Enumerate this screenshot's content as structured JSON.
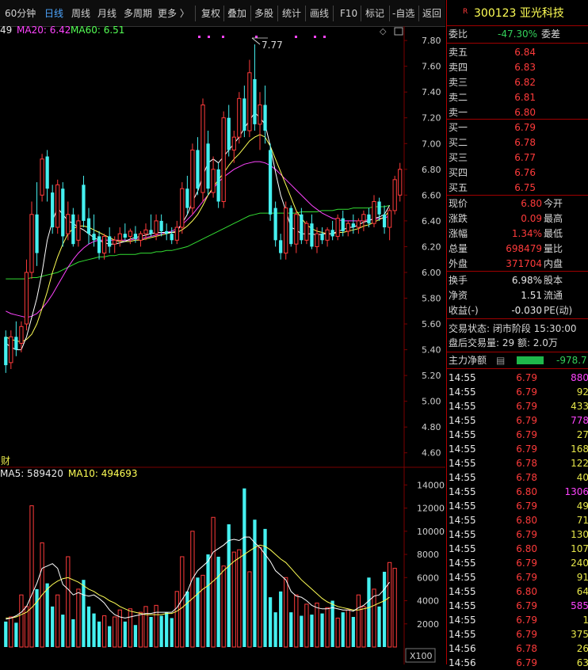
{
  "colors": {
    "up": "#ff3b3b",
    "down": "#45f0f0",
    "ma5": "#ffffff",
    "ma20": "#ff44ff",
    "ma60": "#33ff33",
    "ma10": "#ffff55"
  },
  "toolbar": {
    "items": [
      "60分钟",
      "日线",
      "周线",
      "月线",
      "多周期",
      "更多 〉",
      "复权",
      "叠加",
      "多股",
      "统计",
      "画线",
      "F10",
      "标记",
      "-自选",
      "返回"
    ],
    "active_index": 1
  },
  "price_legend": {
    "ma5_partial": "49",
    "ma20": "MA20: 6.42",
    "ma60": "MA60: 6.51"
  },
  "max_marker": "7.77",
  "price_axis": [
    "7.80",
    "7.60",
    "7.40",
    "7.20",
    "7.00",
    "6.80",
    "6.60",
    "6.40",
    "6.20",
    "6.00",
    "5.80",
    "5.60",
    "5.40",
    "5.20",
    "5.00",
    "4.80",
    "4.60"
  ],
  "finance_tag": "财",
  "vol_legend": {
    "ma5": "MA5: 589420",
    "ma10": "MA10: 494693"
  },
  "vol_axis": [
    "14000",
    "12000",
    "10000",
    "8000",
    "6000",
    "4000",
    "2000"
  ],
  "vol_unit": "X100",
  "stock": {
    "badge": "R",
    "code_name": "300123 亚光科技"
  },
  "weibi": {
    "label": "委比",
    "value": "-47.30%",
    "label2": "委差"
  },
  "asks": [
    {
      "label": "卖五",
      "price": "6.84"
    },
    {
      "label": "卖四",
      "price": "6.83"
    },
    {
      "label": "卖三",
      "price": "6.82"
    },
    {
      "label": "卖二",
      "price": "6.81"
    },
    {
      "label": "卖一",
      "price": "6.80"
    }
  ],
  "bids": [
    {
      "label": "买一",
      "price": "6.79"
    },
    {
      "label": "买二",
      "price": "6.78"
    },
    {
      "label": "买三",
      "price": "6.77"
    },
    {
      "label": "买四",
      "price": "6.76"
    },
    {
      "label": "买五",
      "price": "6.75"
    }
  ],
  "quote": [
    {
      "label": "现价",
      "value": "6.80",
      "label2": "今开"
    },
    {
      "label": "涨跌",
      "value": "0.09",
      "label2": "最高"
    },
    {
      "label": "涨幅",
      "value": "1.34%",
      "label2": "最低"
    },
    {
      "label": "总量",
      "value": "698479",
      "label2": "量比"
    },
    {
      "label": "外盘",
      "value": "371704",
      "label2": "内盘"
    }
  ],
  "stats": [
    {
      "label": "换手",
      "value": "6.98%",
      "label2": "股本"
    },
    {
      "label": "净资",
      "value": "1.51",
      "label2": "流通"
    },
    {
      "label": "收益(-)",
      "value": "-0.030",
      "label2": "PE(动)"
    }
  ],
  "status": {
    "line1": "交易状态: 闭市阶段 15:30:00",
    "line2": "盘后交易量: 29  额: 2.0万"
  },
  "main_flow": {
    "label": "主力净额",
    "value": "-978.7"
  },
  "ticks": [
    {
      "t": "14:55",
      "p": "6.79",
      "v": "880",
      "c": "mag"
    },
    {
      "t": "14:55",
      "p": "6.79",
      "v": "92",
      "c": "yel"
    },
    {
      "t": "14:55",
      "p": "6.79",
      "v": "433",
      "c": "yel"
    },
    {
      "t": "14:55",
      "p": "6.79",
      "v": "778",
      "c": "mag"
    },
    {
      "t": "14:55",
      "p": "6.79",
      "v": "27",
      "c": "yel"
    },
    {
      "t": "14:55",
      "p": "6.79",
      "v": "168",
      "c": "yel"
    },
    {
      "t": "14:55",
      "p": "6.78",
      "v": "122",
      "c": "yel"
    },
    {
      "t": "14:55",
      "p": "6.78",
      "v": "40",
      "c": "yel"
    },
    {
      "t": "14:55",
      "p": "6.80",
      "v": "1306",
      "c": "mag"
    },
    {
      "t": "14:55",
      "p": "6.79",
      "v": "49",
      "c": "yel"
    },
    {
      "t": "14:55",
      "p": "6.80",
      "v": "71",
      "c": "yel"
    },
    {
      "t": "14:55",
      "p": "6.79",
      "v": "130",
      "c": "yel"
    },
    {
      "t": "14:55",
      "p": "6.80",
      "v": "107",
      "c": "yel"
    },
    {
      "t": "14:55",
      "p": "6.79",
      "v": "240",
      "c": "yel"
    },
    {
      "t": "14:55",
      "p": "6.79",
      "v": "91",
      "c": "yel"
    },
    {
      "t": "14:55",
      "p": "6.80",
      "v": "64",
      "c": "yel"
    },
    {
      "t": "14:55",
      "p": "6.79",
      "v": "585",
      "c": "mag"
    },
    {
      "t": "14:55",
      "p": "6.79",
      "v": "1",
      "c": "yel"
    },
    {
      "t": "14:55",
      "p": "6.79",
      "v": "375",
      "c": "yel"
    },
    {
      "t": "14:56",
      "p": "6.78",
      "v": "26",
      "c": "yel"
    },
    {
      "t": "14:56",
      "p": "6.79",
      "v": "63",
      "c": "yel"
    }
  ],
  "chart_data": {
    "type": "candlestick",
    "title": "",
    "y_range": [
      4.5,
      7.85
    ],
    "vol_range": [
      0,
      14500
    ],
    "series": [
      {
        "o": 5.5,
        "h": 5.55,
        "l": 5.22,
        "c": 5.28
      },
      {
        "o": 5.3,
        "h": 5.55,
        "l": 5.25,
        "c": 5.5
      },
      {
        "o": 5.5,
        "h": 5.62,
        "l": 5.35,
        "c": 5.4
      },
      {
        "o": 5.45,
        "h": 5.62,
        "l": 5.38,
        "c": 5.58
      },
      {
        "o": 5.6,
        "h": 6.1,
        "l": 5.55,
        "c": 6.0
      },
      {
        "o": 6.0,
        "h": 6.55,
        "l": 5.95,
        "c": 6.45
      },
      {
        "o": 6.45,
        "h": 6.7,
        "l": 6.05,
        "c": 6.15
      },
      {
        "o": 6.6,
        "h": 6.92,
        "l": 6.55,
        "c": 6.88
      },
      {
        "o": 6.9,
        "h": 6.95,
        "l": 6.55,
        "c": 6.65
      },
      {
        "o": 6.62,
        "h": 6.68,
        "l": 6.3,
        "c": 6.35
      },
      {
        "o": 6.35,
        "h": 6.72,
        "l": 6.3,
        "c": 6.68
      },
      {
        "o": 6.65,
        "h": 6.7,
        "l": 6.2,
        "c": 6.28
      },
      {
        "o": 6.3,
        "h": 6.55,
        "l": 6.25,
        "c": 6.45
      },
      {
        "o": 6.45,
        "h": 6.5,
        "l": 6.2,
        "c": 6.22
      },
      {
        "o": 6.25,
        "h": 6.45,
        "l": 6.2,
        "c": 6.4
      },
      {
        "o": 6.68,
        "h": 6.75,
        "l": 6.35,
        "c": 6.4
      },
      {
        "o": 6.42,
        "h": 6.5,
        "l": 6.22,
        "c": 6.3
      },
      {
        "o": 6.3,
        "h": 6.45,
        "l": 6.2,
        "c": 6.25
      },
      {
        "o": 6.28,
        "h": 6.32,
        "l": 6.1,
        "c": 6.15
      },
      {
        "o": 6.15,
        "h": 6.3,
        "l": 6.1,
        "c": 6.28
      },
      {
        "o": 6.28,
        "h": 6.35,
        "l": 6.15,
        "c": 6.2
      },
      {
        "o": 6.22,
        "h": 6.28,
        "l": 6.15,
        "c": 6.25
      },
      {
        "o": 6.25,
        "h": 6.35,
        "l": 6.2,
        "c": 6.3
      },
      {
        "o": 6.3,
        "h": 6.38,
        "l": 6.25,
        "c": 6.27
      },
      {
        "o": 6.28,
        "h": 6.34,
        "l": 6.22,
        "c": 6.32
      },
      {
        "o": 6.3,
        "h": 6.36,
        "l": 6.23,
        "c": 6.26
      },
      {
        "o": 6.25,
        "h": 6.32,
        "l": 6.2,
        "c": 6.3
      },
      {
        "o": 6.3,
        "h": 6.38,
        "l": 6.25,
        "c": 6.33
      },
      {
        "o": 6.33,
        "h": 6.45,
        "l": 6.28,
        "c": 6.3
      },
      {
        "o": 6.3,
        "h": 6.45,
        "l": 6.25,
        "c": 6.4
      },
      {
        "o": 6.4,
        "h": 6.45,
        "l": 6.28,
        "c": 6.32
      },
      {
        "o": 6.32,
        "h": 6.38,
        "l": 6.25,
        "c": 6.3
      },
      {
        "o": 6.3,
        "h": 6.35,
        "l": 6.22,
        "c": 6.25
      },
      {
        "o": 6.25,
        "h": 6.4,
        "l": 6.22,
        "c": 6.35
      },
      {
        "o": 6.35,
        "h": 6.7,
        "l": 6.3,
        "c": 6.65
      },
      {
        "o": 6.65,
        "h": 6.75,
        "l": 6.45,
        "c": 6.5
      },
      {
        "o": 6.5,
        "h": 7.0,
        "l": 6.45,
        "c": 6.95
      },
      {
        "o": 6.95,
        "h": 7.05,
        "l": 6.6,
        "c": 6.65
      },
      {
        "o": 6.62,
        "h": 7.35,
        "l": 6.55,
        "c": 7.3
      },
      {
        "o": 7.0,
        "h": 7.1,
        "l": 6.6,
        "c": 6.65
      },
      {
        "o": 6.62,
        "h": 6.9,
        "l": 6.58,
        "c": 6.8
      },
      {
        "o": 6.8,
        "h": 6.85,
        "l": 6.5,
        "c": 6.55
      },
      {
        "o": 6.55,
        "h": 7.25,
        "l": 6.5,
        "c": 7.2
      },
      {
        "o": 7.2,
        "h": 7.3,
        "l": 6.9,
        "c": 6.95
      },
      {
        "o": 6.95,
        "h": 7.1,
        "l": 6.85,
        "c": 7.05
      },
      {
        "o": 7.05,
        "h": 7.4,
        "l": 7.0,
        "c": 7.35
      },
      {
        "o": 7.35,
        "h": 7.45,
        "l": 7.05,
        "c": 7.1
      },
      {
        "o": 7.1,
        "h": 7.65,
        "l": 7.05,
        "c": 7.55
      },
      {
        "o": 7.5,
        "h": 7.77,
        "l": 7.1,
        "c": 7.15
      },
      {
        "o": 7.15,
        "h": 7.4,
        "l": 6.95,
        "c": 7.3
      },
      {
        "o": 7.3,
        "h": 7.45,
        "l": 7.0,
        "c": 7.1
      },
      {
        "o": 6.95,
        "h": 7.0,
        "l": 6.4,
        "c": 6.45
      },
      {
        "o": 6.5,
        "h": 6.55,
        "l": 6.2,
        "c": 6.25
      },
      {
        "o": 6.25,
        "h": 6.3,
        "l": 6.1,
        "c": 6.15
      },
      {
        "o": 6.15,
        "h": 6.55,
        "l": 6.1,
        "c": 6.5
      },
      {
        "o": 6.5,
        "h": 6.52,
        "l": 6.2,
        "c": 6.22
      },
      {
        "o": 6.22,
        "h": 6.48,
        "l": 6.15,
        "c": 6.45
      },
      {
        "o": 6.45,
        "h": 6.5,
        "l": 6.22,
        "c": 6.25
      },
      {
        "o": 6.25,
        "h": 6.4,
        "l": 6.22,
        "c": 6.38
      },
      {
        "o": 6.38,
        "h": 6.45,
        "l": 6.18,
        "c": 6.2
      },
      {
        "o": 6.2,
        "h": 6.35,
        "l": 6.15,
        "c": 6.3
      },
      {
        "o": 6.3,
        "h": 6.35,
        "l": 6.22,
        "c": 6.25
      },
      {
        "o": 6.25,
        "h": 6.35,
        "l": 6.2,
        "c": 6.33
      },
      {
        "o": 6.33,
        "h": 6.4,
        "l": 6.25,
        "c": 6.28
      },
      {
        "o": 6.28,
        "h": 6.45,
        "l": 6.25,
        "c": 6.42
      },
      {
        "o": 6.42,
        "h": 6.48,
        "l": 6.28,
        "c": 6.32
      },
      {
        "o": 6.32,
        "h": 6.4,
        "l": 6.28,
        "c": 6.38
      },
      {
        "o": 6.38,
        "h": 6.45,
        "l": 6.3,
        "c": 6.35
      },
      {
        "o": 6.35,
        "h": 6.42,
        "l": 6.3,
        "c": 6.4
      },
      {
        "o": 6.4,
        "h": 6.48,
        "l": 6.32,
        "c": 6.45
      },
      {
        "o": 6.45,
        "h": 6.5,
        "l": 6.35,
        "c": 6.38
      },
      {
        "o": 6.38,
        "h": 6.6,
        "l": 6.35,
        "c": 6.55
      },
      {
        "o": 6.55,
        "h": 6.58,
        "l": 6.4,
        "c": 6.45
      },
      {
        "o": 6.45,
        "h": 6.52,
        "l": 6.3,
        "c": 6.35
      },
      {
        "o": 6.35,
        "h": 6.5,
        "l": 6.25,
        "c": 6.48
      },
      {
        "o": 6.48,
        "h": 6.75,
        "l": 6.45,
        "c": 6.72
      },
      {
        "o": 6.6,
        "h": 6.85,
        "l": 6.55,
        "c": 6.8
      }
    ],
    "volume": [
      2200,
      2600,
      2100,
      4500,
      3500,
      12200,
      5000,
      9000,
      5500,
      3500,
      4500,
      2800,
      7800,
      2400,
      5000,
      5800,
      3500,
      2900,
      2200,
      2700,
      1800,
      2600,
      3200,
      2200,
      3300,
      1900,
      3000,
      3500,
      2600,
      3600,
      2700,
      3000,
      2500,
      4800,
      7800,
      4800,
      10000,
      6000,
      6200,
      8000,
      11200,
      7800,
      7000,
      10600,
      8200,
      8400,
      13700,
      6500,
      11000,
      8600,
      10200,
      4300,
      3000,
      4800,
      6000,
      3000,
      4500,
      2700,
      3700,
      2800,
      3800,
      2900,
      3400,
      4000,
      2500,
      3000,
      3200,
      2600,
      4500,
      3500,
      6000,
      5000,
      3500,
      6500,
      7300,
      6800
    ],
    "ma5": [
      5.45,
      5.42,
      5.4,
      5.4,
      5.5,
      5.65,
      5.8,
      6.0,
      6.25,
      6.4,
      6.5,
      6.45,
      6.4,
      6.38,
      6.35,
      6.33,
      6.3,
      6.27,
      6.25,
      6.23,
      6.22,
      6.22,
      6.23,
      6.24,
      6.26,
      6.27,
      6.28,
      6.29,
      6.3,
      6.31,
      6.31,
      6.31,
      6.31,
      6.32,
      6.38,
      6.45,
      6.55,
      6.63,
      6.75,
      6.85,
      6.88,
      6.85,
      6.9,
      6.95,
      7.0,
      7.05,
      7.12,
      7.18,
      7.24,
      7.2,
      7.15,
      6.98,
      6.78,
      6.6,
      6.48,
      6.35,
      6.33,
      6.3,
      6.3,
      6.3,
      6.29,
      6.3,
      6.3,
      6.3,
      6.32,
      6.33,
      6.35,
      6.35,
      6.37,
      6.39,
      6.4,
      6.42,
      6.43,
      6.45,
      6.52
    ],
    "ma10": [
      5.5,
      5.48,
      5.47,
      5.46,
      5.48,
      5.52,
      5.6,
      5.72,
      5.85,
      6.0,
      6.12,
      6.22,
      6.3,
      6.34,
      6.36,
      6.36,
      6.35,
      6.33,
      6.31,
      6.29,
      6.27,
      6.25,
      6.24,
      6.24,
      6.24,
      6.25,
      6.25,
      6.26,
      6.27,
      6.28,
      6.29,
      6.3,
      6.31,
      6.31,
      6.33,
      6.36,
      6.4,
      6.45,
      6.52,
      6.6,
      6.66,
      6.72,
      6.77,
      6.83,
      6.88,
      6.92,
      6.97,
      7.02,
      7.05,
      7.07,
      7.05,
      6.98,
      6.88,
      6.78,
      6.68,
      6.58,
      6.48,
      6.42,
      6.37,
      6.34,
      6.32,
      6.31,
      6.3,
      6.3,
      6.31,
      6.31,
      6.32,
      6.33,
      6.34,
      6.36,
      6.37,
      6.39,
      6.41,
      6.43,
      6.48
    ],
    "ma20": [
      5.7,
      5.68,
      5.67,
      5.66,
      5.65,
      5.66,
      5.68,
      5.72,
      5.77,
      5.83,
      5.9,
      5.97,
      6.04,
      6.1,
      6.15,
      6.19,
      6.22,
      6.24,
      6.25,
      6.25,
      6.25,
      6.25,
      6.25,
      6.25,
      6.25,
      6.26,
      6.26,
      6.27,
      6.28,
      6.29,
      6.3,
      6.31,
      6.32,
      6.34,
      6.37,
      6.41,
      6.45,
      6.5,
      6.55,
      6.6,
      6.65,
      6.7,
      6.74,
      6.77,
      6.8,
      6.82,
      6.84,
      6.85,
      6.86,
      6.86,
      6.85,
      6.83,
      6.8,
      6.76,
      6.72,
      6.68,
      6.64,
      6.6,
      6.56,
      6.52,
      6.49,
      6.46,
      6.44,
      6.42,
      6.41,
      6.4,
      6.4,
      6.4,
      6.4,
      6.4,
      6.41,
      6.41,
      6.42,
      6.42,
      6.44
    ],
    "ma60": [
      5.95,
      5.95,
      5.95,
      5.95,
      5.95,
      5.96,
      5.96,
      5.97,
      5.98,
      5.99,
      6.0,
      6.02,
      6.04,
      6.06,
      6.08,
      6.09,
      6.1,
      6.11,
      6.12,
      6.12,
      6.13,
      6.13,
      6.14,
      6.14,
      6.14,
      6.14,
      6.15,
      6.15,
      6.15,
      6.16,
      6.16,
      6.17,
      6.17,
      6.18,
      6.19,
      6.2,
      6.22,
      6.24,
      6.26,
      6.28,
      6.3,
      6.32,
      6.34,
      6.36,
      6.38,
      6.4,
      6.42,
      6.44,
      6.45,
      6.46,
      6.46,
      6.46,
      6.46,
      6.46,
      6.46,
      6.46,
      6.46,
      6.47,
      6.47,
      6.47,
      6.47,
      6.48,
      6.48,
      6.48,
      6.49,
      6.49,
      6.49,
      6.5,
      6.5,
      6.5,
      6.5,
      6.51,
      6.51,
      6.51,
      6.52
    ],
    "vol_ma5": [
      2400,
      2500,
      2700,
      3000,
      3500,
      4500,
      5500,
      6800,
      7000,
      7200,
      6800,
      5400,
      5000,
      4500,
      4700,
      4500,
      4400,
      4500,
      4200,
      3800,
      3200,
      2800,
      2600,
      2500,
      2600,
      2700,
      2800,
      2900,
      2900,
      3000,
      3000,
      3000,
      3000,
      3400,
      4100,
      4800,
      5900,
      6600,
      7000,
      7400,
      8200,
      8500,
      8800,
      9200,
      9300,
      9200,
      9500,
      9500,
      9000,
      8600,
      8000,
      7400,
      6600,
      6200,
      5800,
      4800,
      4400,
      4300,
      4000,
      3600,
      3400,
      3300,
      3300,
      3400,
      3300,
      3200,
      3200,
      3100,
      3400,
      3600,
      4000,
      4400,
      4500,
      5000,
      5600
    ],
    "vol_ma10": [
      2500,
      2500,
      2600,
      2800,
      3000,
      3400,
      3900,
      4500,
      5000,
      5400,
      5700,
      5900,
      6000,
      5800,
      5600,
      5300,
      5000,
      4800,
      4500,
      4300,
      4000,
      3800,
      3500,
      3300,
      3100,
      3000,
      2900,
      2800,
      2800,
      2800,
      2800,
      2900,
      2900,
      3100,
      3400,
      3800,
      4200,
      4600,
      5000,
      5300,
      5700,
      6100,
      6600,
      7000,
      7400,
      7700,
      8000,
      8300,
      8600,
      8800,
      8700,
      8400,
      8000,
      7600,
      7300,
      6800,
      6300,
      5800,
      5400,
      5000,
      4600,
      4200,
      3900,
      3700,
      3500,
      3400,
      3300,
      3200,
      3200,
      3300,
      3400,
      3600,
      3800,
      4000,
      4300
    ]
  }
}
